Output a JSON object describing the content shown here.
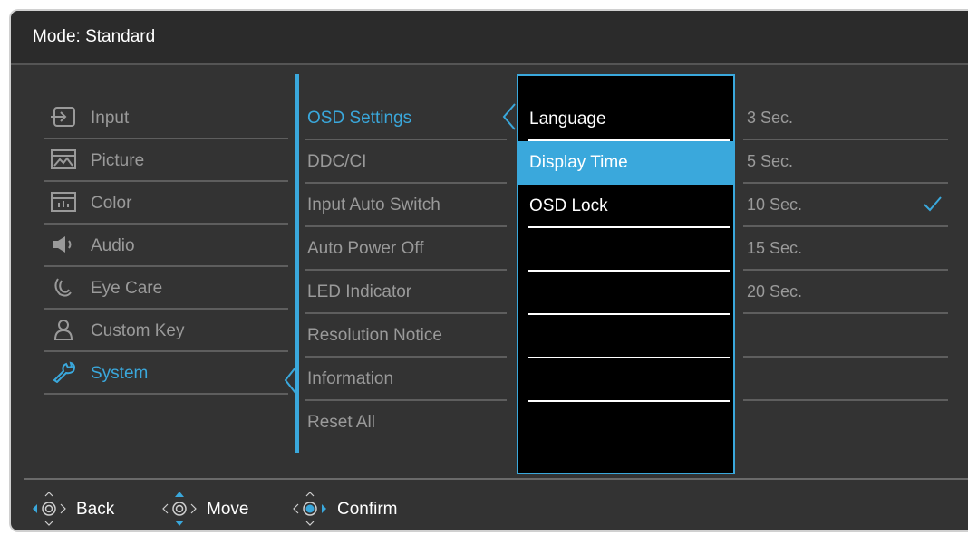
{
  "header": {
    "title": "Mode: Standard"
  },
  "main_menu": [
    {
      "icon": "input-icon",
      "label": "Input",
      "active": false
    },
    {
      "icon": "picture-icon",
      "label": "Picture",
      "active": false
    },
    {
      "icon": "color-icon",
      "label": "Color",
      "active": false
    },
    {
      "icon": "audio-icon",
      "label": "Audio",
      "active": false
    },
    {
      "icon": "eye-care-icon",
      "label": "Eye Care",
      "active": false
    },
    {
      "icon": "custom-key-icon",
      "label": "Custom Key",
      "active": false
    },
    {
      "icon": "system-icon",
      "label": "System",
      "active": true
    }
  ],
  "submenu": [
    {
      "label": "OSD Settings",
      "active": true
    },
    {
      "label": "DDC/CI",
      "active": false
    },
    {
      "label": "Input Auto Switch",
      "active": false
    },
    {
      "label": "Auto Power Off",
      "active": false
    },
    {
      "label": "LED Indicator",
      "active": false
    },
    {
      "label": "Resolution Notice",
      "active": false
    },
    {
      "label": "Information",
      "active": false
    },
    {
      "label": "Reset All",
      "active": false
    }
  ],
  "osd_settings": [
    {
      "label": "Language",
      "selected": false
    },
    {
      "label": "Display Time",
      "selected": true
    },
    {
      "label": "OSD Lock",
      "selected": false
    },
    {
      "label": "",
      "selected": false
    },
    {
      "label": "",
      "selected": false
    },
    {
      "label": "",
      "selected": false
    },
    {
      "label": "",
      "selected": false
    }
  ],
  "display_time_options": [
    {
      "label": "3 Sec.",
      "checked": false
    },
    {
      "label": "5 Sec.",
      "checked": false
    },
    {
      "label": "10 Sec.",
      "checked": true
    },
    {
      "label": "15 Sec.",
      "checked": false
    },
    {
      "label": "20 Sec.",
      "checked": false
    },
    {
      "label": "",
      "checked": false
    },
    {
      "label": "",
      "checked": false
    }
  ],
  "footer": {
    "back_label": "Back",
    "move_label": "Move",
    "confirm_label": "Confirm"
  },
  "colors": {
    "accent": "#3aa8dc",
    "background": "#333333",
    "text_dim": "#9a9a9a",
    "text_bright": "#ffffff"
  }
}
